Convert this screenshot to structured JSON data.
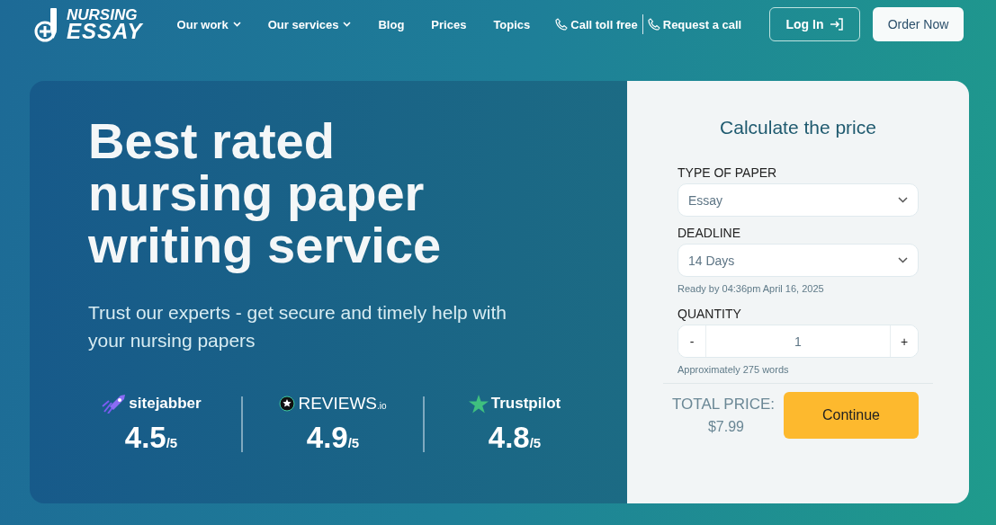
{
  "logo": {
    "line_1": "NURSING",
    "line_2": "ESSAY"
  },
  "nav": [
    {
      "label": "Our work",
      "dropdown": true
    },
    {
      "label": "Our services",
      "dropdown": true
    },
    {
      "label": "Blog",
      "dropdown": false
    },
    {
      "label": "Prices",
      "dropdown": false
    },
    {
      "label": "Topics",
      "dropdown": false
    }
  ],
  "contacts": [
    "Call toll free",
    "Request a call"
  ],
  "header_buttons": {
    "login": "Log In",
    "order": "Order Now"
  },
  "hero": {
    "title": "Best rated nursing paper writing service",
    "subtitle": "Trust our experts - get secure and timely help with your nursing papers"
  },
  "ratings": [
    {
      "kind": "sitejabber",
      "name": "sitejabber",
      "score": "4.5",
      "out_of": "/5"
    },
    {
      "kind": "reviews",
      "name": "REVIEWS",
      "suffix": ".io",
      "score": "4.9",
      "out_of": "/5"
    },
    {
      "kind": "trustpilot",
      "name": "Trustpilot",
      "score": "4.8",
      "out_of": "/5"
    }
  ],
  "calculator": {
    "title": "Calculate the price",
    "paper_label": "TYPE OF PAPER",
    "paper_value": "Essay",
    "deadline_label": "DEADLINE",
    "deadline_value": "14 Days",
    "ready_note": "Ready by 04:36pm April 16, 2025",
    "quantity_label": "QUANTITY",
    "minus": "-",
    "quantity": "1",
    "plus": "+",
    "words_note": "Approximately 275 words",
    "total_label": "TOTAL PRICE:",
    "total": "$7.99",
    "continue": "Continue"
  }
}
